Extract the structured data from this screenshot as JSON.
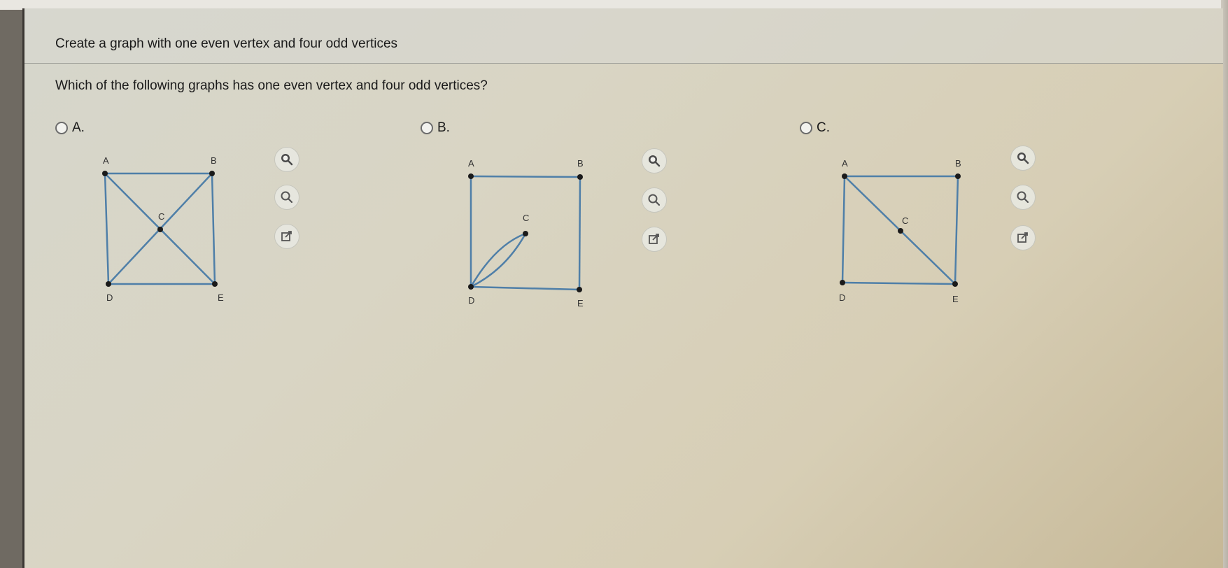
{
  "header": {
    "title": "Create a graph with one even vertex and four odd vertices"
  },
  "question": {
    "text": "Which of the following graphs has one even vertex and four odd vertices?"
  },
  "choices": [
    {
      "label": "A.",
      "vertices": {
        "A": "A",
        "B": "B",
        "C": "C",
        "D": "D",
        "E": "E"
      },
      "edges": [
        "A-B",
        "A-D",
        "B-E",
        "D-E",
        "A-C",
        "C-E",
        "B-C",
        "C-D"
      ]
    },
    {
      "label": "B.",
      "vertices": {
        "A": "A",
        "B": "B",
        "C": "C",
        "D": "D",
        "E": "E"
      },
      "edges": [
        "A-B",
        "A-D",
        "B-E",
        "D-E",
        "C-D",
        "C-D"
      ]
    },
    {
      "label": "C.",
      "vertices": {
        "A": "A",
        "B": "B",
        "C": "C",
        "D": "D",
        "E": "E"
      },
      "edges": [
        "A-B",
        "A-D",
        "B-E",
        "D-E",
        "A-C",
        "C-E"
      ]
    }
  ],
  "tools": [
    "zoom-in-icon",
    "zoom-out-icon",
    "open-external-icon"
  ],
  "colors": {
    "edge": "#4f7fa8",
    "vertex": "#1a1a1a"
  }
}
